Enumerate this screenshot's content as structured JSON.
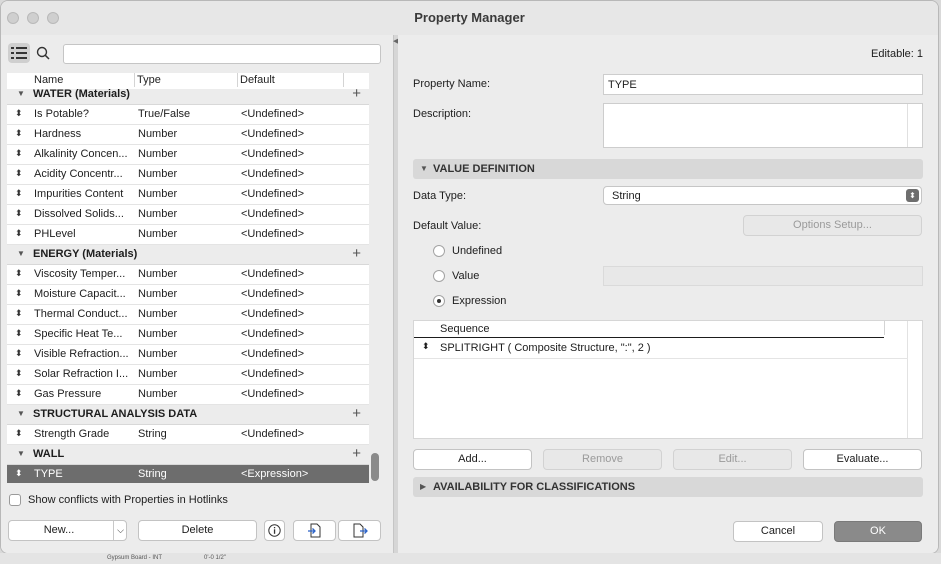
{
  "window": {
    "title": "Property Manager"
  },
  "left": {
    "columns": {
      "name": "Name",
      "type": "Type",
      "default": "Default"
    },
    "groups": [
      {
        "name": "WATER (Materials)",
        "rows": [
          {
            "name": "Is Potable?",
            "type": "True/False",
            "default": "<Undefined>"
          },
          {
            "name": "Hardness",
            "type": "Number",
            "default": "<Undefined>"
          },
          {
            "name": "Alkalinity Concen...",
            "type": "Number",
            "default": "<Undefined>"
          },
          {
            "name": "Acidity Concentr...",
            "type": "Number",
            "default": "<Undefined>"
          },
          {
            "name": "Impurities Content",
            "type": "Number",
            "default": "<Undefined>"
          },
          {
            "name": "Dissolved Solids...",
            "type": "Number",
            "default": "<Undefined>"
          },
          {
            "name": "PHLevel",
            "type": "Number",
            "default": "<Undefined>"
          }
        ]
      },
      {
        "name": "ENERGY (Materials)",
        "rows": [
          {
            "name": "Viscosity Temper...",
            "type": "Number",
            "default": "<Undefined>"
          },
          {
            "name": "Moisture Capacit...",
            "type": "Number",
            "default": "<Undefined>"
          },
          {
            "name": "Thermal Conduct...",
            "type": "Number",
            "default": "<Undefined>"
          },
          {
            "name": "Specific Heat Te...",
            "type": "Number",
            "default": "<Undefined>"
          },
          {
            "name": "Visible Refraction...",
            "type": "Number",
            "default": "<Undefined>"
          },
          {
            "name": "Solar Refraction I...",
            "type": "Number",
            "default": "<Undefined>"
          },
          {
            "name": "Gas Pressure",
            "type": "Number",
            "default": "<Undefined>"
          }
        ]
      },
      {
        "name": "STRUCTURAL ANALYSIS DATA",
        "rows": [
          {
            "name": "Strength Grade",
            "type": "String",
            "default": "<Undefined>"
          }
        ]
      },
      {
        "name": "WALL",
        "rows": [
          {
            "name": "TYPE",
            "type": "String",
            "default": "<Expression>",
            "selected": true
          }
        ]
      }
    ],
    "show_conflicts_label": "Show conflicts with Properties in Hotlinks",
    "new_label": "New...",
    "delete_label": "Delete"
  },
  "right": {
    "editable": "Editable: 1",
    "property_name_label": "Property Name:",
    "property_name_value": "TYPE",
    "description_label": "Description:",
    "value_definition": "VALUE DEFINITION",
    "data_type_label": "Data Type:",
    "data_type_value": "String",
    "default_value_label": "Default Value:",
    "options_setup": "Options Setup...",
    "radio_undefined": "Undefined",
    "radio_value": "Value",
    "radio_expression": "Expression",
    "sequence_header": "Sequence",
    "sequence_row": "SPLITRIGHT ( Composite Structure, \":\", 2 )",
    "add": "Add...",
    "remove": "Remove",
    "edit": "Edit...",
    "evaluate": "Evaluate...",
    "availability": "AVAILABILITY FOR CLASSIFICATIONS",
    "cancel": "Cancel",
    "ok": "OK"
  },
  "background": {
    "text1": "Gypsum Board - INT",
    "text2": "0'-0 1/2\""
  }
}
